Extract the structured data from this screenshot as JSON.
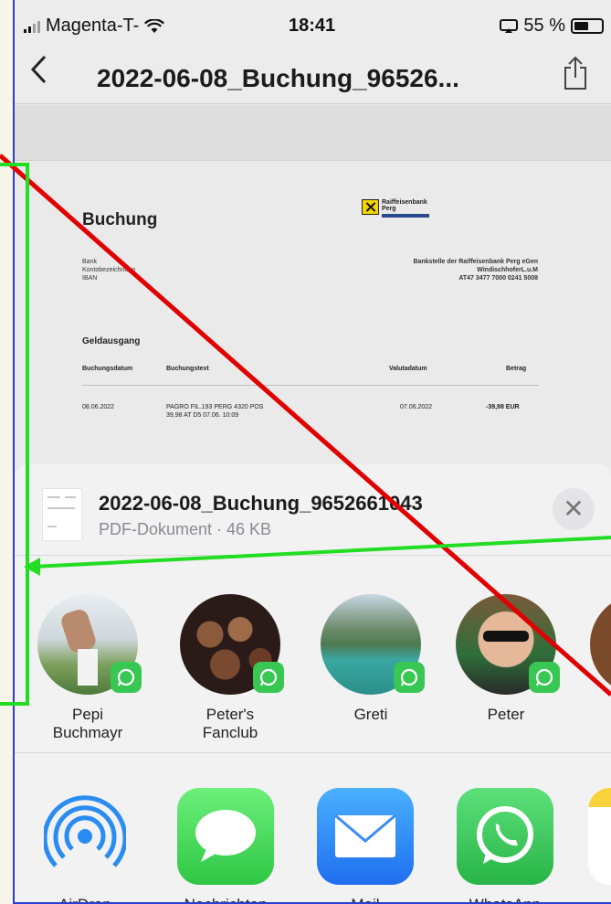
{
  "status_bar": {
    "carrier": "Magenta-T-",
    "time": "18:41",
    "battery_percent": "55 %",
    "battery_level": 0.55
  },
  "nav": {
    "back_icon": "chevron-left-icon",
    "title": "2022-06-08_Buchung_96526...",
    "share_icon": "share-icon"
  },
  "document": {
    "heading": "Buchung",
    "bank_logo_text": [
      "Raiffeisenbank",
      "Perg"
    ],
    "bank_labels": [
      "Bank",
      "Kontobezeichnung",
      "IBAN"
    ],
    "bank_values": [
      "Bankstelle der Raiffeisenbank Perg eGen",
      "WindischhoferL.u.M",
      "AT47 3477 7000 0241 5008"
    ],
    "section": "Geldausgang",
    "table_headers": [
      "Buchungsdatum",
      "Buchungstext",
      "Valutadatum",
      "Betrag"
    ],
    "row": {
      "date": "08.06.2022",
      "text_line1": "PAGRO FIL.193 PERG 4320 POS",
      "text_line2": "39,98 AT D5 07.06. 10:09",
      "value_date": "07.06.2022",
      "amount": "-39,98 EUR"
    }
  },
  "share_sheet": {
    "file_name": "2022-06-08_Buchung_9652661043",
    "file_meta": "PDF-Dokument · 46 KB",
    "close_icon": "close-icon",
    "people": [
      {
        "name_line1": "Pepi",
        "name_line2": "Buchmayr"
      },
      {
        "name_line1": "Peter's",
        "name_line2": "Fanclub"
      },
      {
        "name_line1": "Greti",
        "name_line2": ""
      },
      {
        "name_line1": "Peter",
        "name_line2": ""
      }
    ],
    "apps": [
      {
        "label": "AirDrop",
        "icon": "airdrop-icon"
      },
      {
        "label": "Nachrichten",
        "icon": "messages-icon"
      },
      {
        "label": "Mail",
        "icon": "mail-icon"
      },
      {
        "label": "WhatsApp",
        "icon": "whatsapp-icon"
      }
    ]
  },
  "colors": {
    "frame_border": "#2a3dd6",
    "annotation_red": "#e00000",
    "annotation_green": "#22dd22",
    "whatsapp_green": "#37c752",
    "mail_blue": "#1f7cf5"
  }
}
